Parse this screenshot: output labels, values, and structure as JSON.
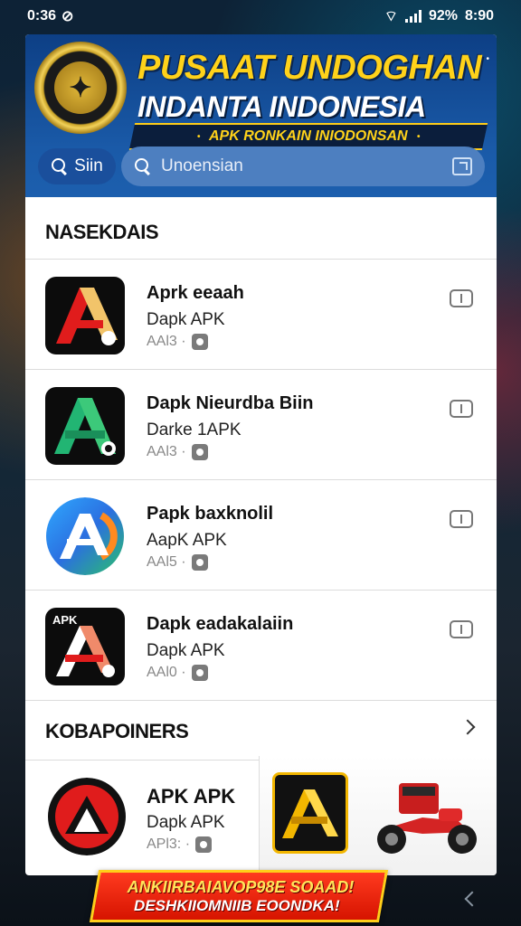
{
  "status_bar": {
    "time": "0:36",
    "battery": "92%",
    "clock_right": "8:90"
  },
  "header": {
    "title_line1": "PUSAAT UNDOGHAN",
    "title_line2": "INDANTA INDONESIA",
    "ribbon": "APK RONKAIN INIODONSAN",
    "sim_button_label": "Siin",
    "search_placeholder": "Unoensian"
  },
  "sections": {
    "first": "NASEKDAIS",
    "second": "KOBAPOINERS"
  },
  "apps": [
    {
      "name": "Aprk eeaah",
      "sub": "Dapk  APK",
      "meta": "AAl3 ·",
      "icon": "red-a-on-black"
    },
    {
      "name": "Dapk Nieurdba Biin",
      "sub": "Darke  1APK",
      "meta": "AAl3 ·",
      "icon": "green-a-on-black"
    },
    {
      "name": "Papk baxknolil",
      "sub": "AapK  APK",
      "meta": "AAl5 ·",
      "icon": "blue-a-on-gradient"
    },
    {
      "name": "Dapk eadakalaiin",
      "sub": "Dapk  APK",
      "meta": "AAl0 ·",
      "icon": "white-a-on-black"
    }
  ],
  "featured_app": {
    "name": "APK APK",
    "sub": "Dapk  APK",
    "meta": "APl3: ·"
  },
  "banner": {
    "line1": "ANKIIRBAIAVOP98E SOAAD!",
    "line2": "DESHKIIOMNIIB EOONDKA!"
  },
  "colors": {
    "header_blue": "#1a5aa8",
    "title_yellow": "#ffd21a",
    "banner_red": "#e01a05"
  }
}
